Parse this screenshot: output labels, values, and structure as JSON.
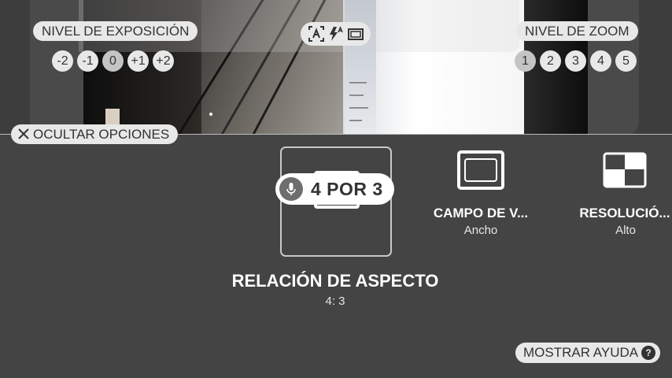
{
  "exposure": {
    "label": "NIVEL DE EXPOSICIÓN",
    "levels": [
      "-2",
      "-1",
      "0",
      "+1",
      "+2"
    ],
    "selected": "0"
  },
  "zoom": {
    "label": "NIVEL DE ZOOM",
    "levels": [
      "1",
      "2",
      "3",
      "4",
      "5"
    ],
    "selected": "1"
  },
  "hide_options": {
    "label": "OCULTAR OPCIONES"
  },
  "aspect": {
    "voice_hint": "4 POR 3",
    "title": "RELACIÓN DE ASPECTO",
    "value": "4: 3"
  },
  "field_of_view": {
    "title": "CAMPO DE V...",
    "value": "Ancho"
  },
  "resolution": {
    "title": "RESOLUCIÓ...",
    "value": "Alto"
  },
  "help": {
    "label": "MOSTRAR AYUDA",
    "icon_text": "?"
  },
  "colors": {
    "background": "#444444",
    "pill": "#e8e8e8",
    "pill_text": "#333333"
  }
}
